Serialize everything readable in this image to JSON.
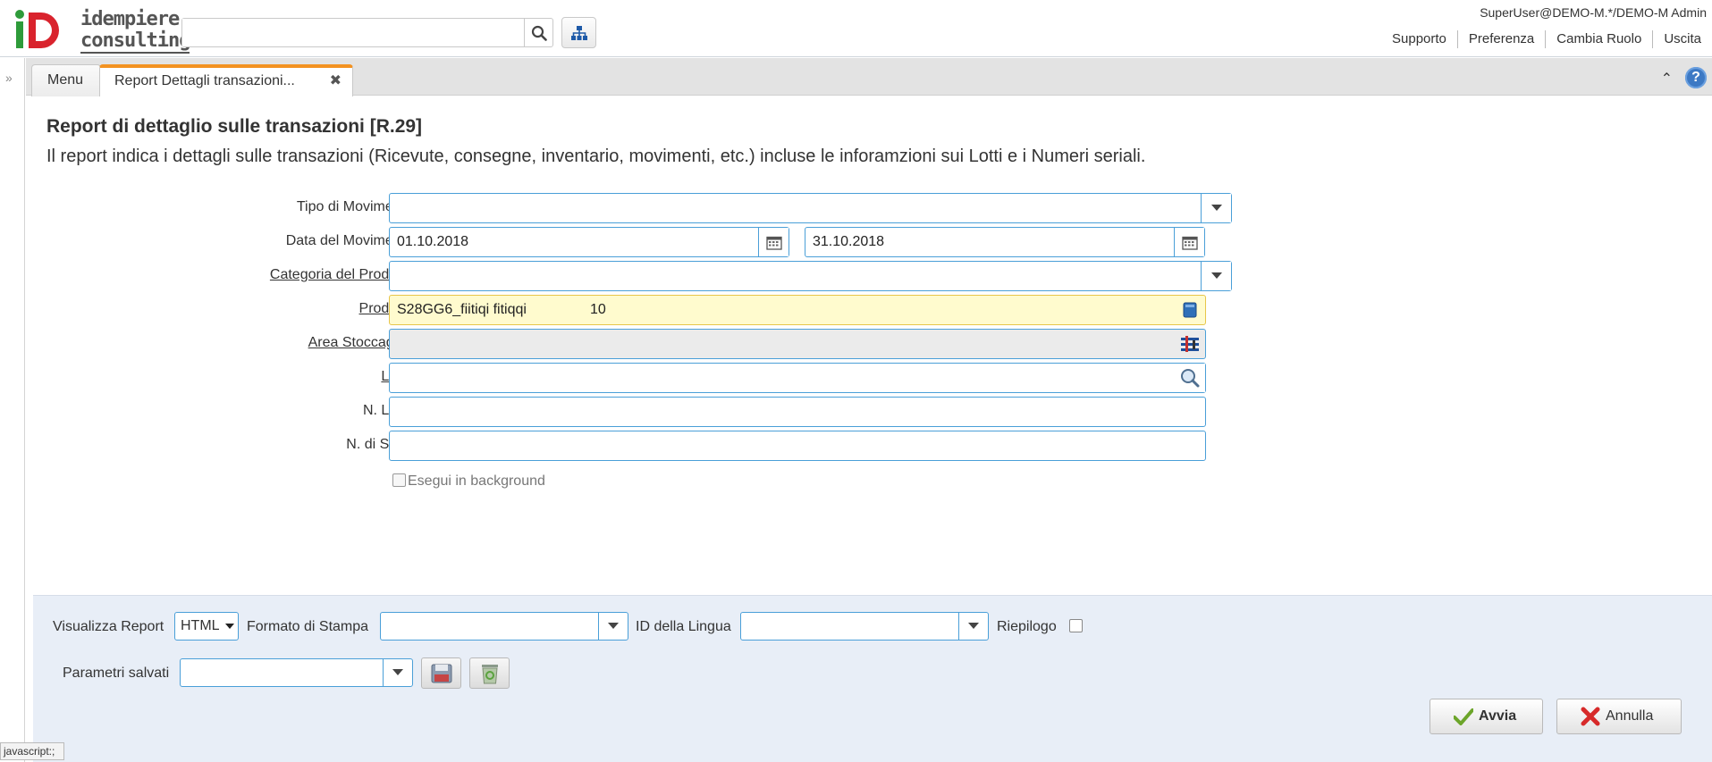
{
  "header": {
    "logo_line1": "idempiere",
    "logo_line2": "consulting",
    "search_value": "",
    "user": "SuperUser@DEMO-M.*/DEMO-M Admin",
    "links": [
      "Supporto",
      "Preferenza",
      "Cambia Ruolo",
      "Uscita"
    ]
  },
  "tabs": {
    "menu": "Menu",
    "active": "Report Dettagli transazioni..."
  },
  "form": {
    "title": "Report di dettaglio sulle transazioni [R.29]",
    "description": "Il report indica i dettagli sulle transazioni (Ricevute, consegne, inventario, movimenti, etc.) incluse le inforamzioni sui Lotti e i Numeri seriali.",
    "fields": {
      "tipo_movimento": {
        "label": "Tipo di Movimento",
        "value": ""
      },
      "data_movimento": {
        "label": "Data del Movimento",
        "from": "01.10.2018",
        "to": "31.10.2018"
      },
      "categoria_prodotto": {
        "label": "Categoria del Prodotto",
        "value": ""
      },
      "prodotto": {
        "label": "Prodotto",
        "value": "S28GG6_fiitiqi fitiqqi",
        "qty": "10"
      },
      "area_stoccaggio": {
        "label": "Area Stoccaggio",
        "value": ""
      },
      "lotto": {
        "label": "Lotto",
        "value": ""
      },
      "n_lotto": {
        "label": "N. Lotto",
        "value": ""
      },
      "n_serie": {
        "label": "N. di Serie",
        "value": ""
      }
    },
    "background_label": "Esegui in background"
  },
  "bottom": {
    "visualizza_label": "Visualizza Report",
    "visualizza_value": "HTML",
    "formato_label": "Formato di Stampa",
    "lingua_label": "ID della Lingua",
    "riepilogo_label": "Riepilogo",
    "parametri_label": "Parametri salvati",
    "avvia": "Avvia",
    "annulla": "Annulla"
  },
  "status_text": "javascript:;"
}
